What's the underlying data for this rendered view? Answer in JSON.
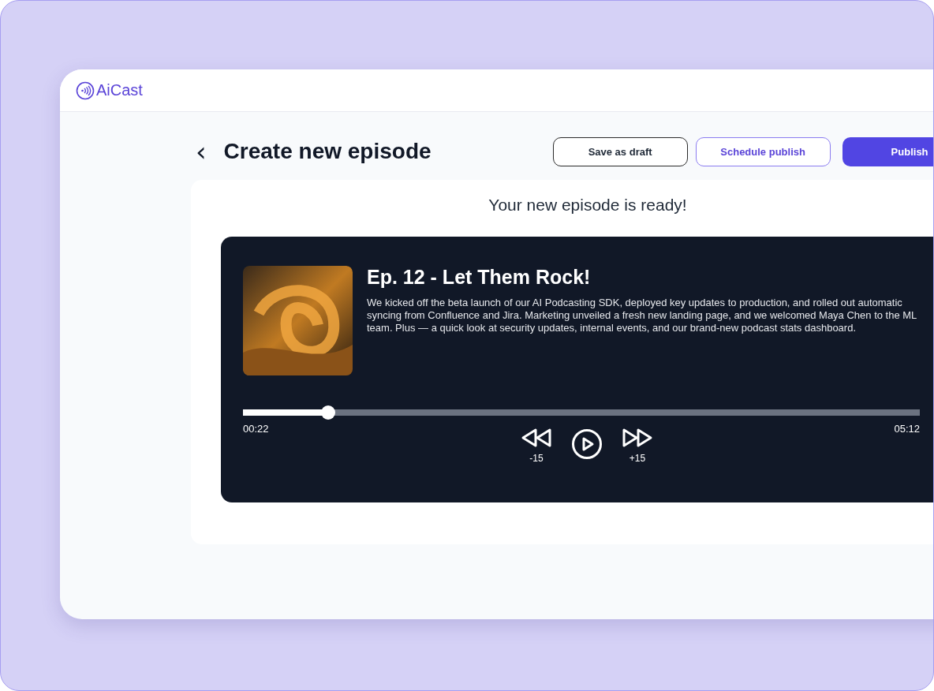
{
  "app": {
    "logo_text": "AiCast"
  },
  "page": {
    "title": "Create new episode",
    "back_label": "‹"
  },
  "actions": [
    {
      "label": "Save as draft",
      "kind": "outline"
    },
    {
      "label": "Schedule publish",
      "kind": "accent-outline"
    },
    {
      "label": "Publish",
      "kind": "primary"
    }
  ],
  "card": {
    "heading": "Your new episode is ready!"
  },
  "episode": {
    "title": "Ep. 12 - Let Them Rock!",
    "description": "We kicked off the beta launch of our AI Podcasting SDK, deployed key updates to production, and rolled out automatic syncing from Confluence and Jira. Marketing unveiled a fresh new landing page, and we welcomed Maya Chen to the ML team. Plus — a quick look at security updates, internal events, and our brand-new podcast stats dashboard.",
    "progress": {
      "level": 0.126
    },
    "elapsed": "00:22",
    "duration": "05:12",
    "rewind_label": "-15",
    "forward_label": "+15"
  }
}
